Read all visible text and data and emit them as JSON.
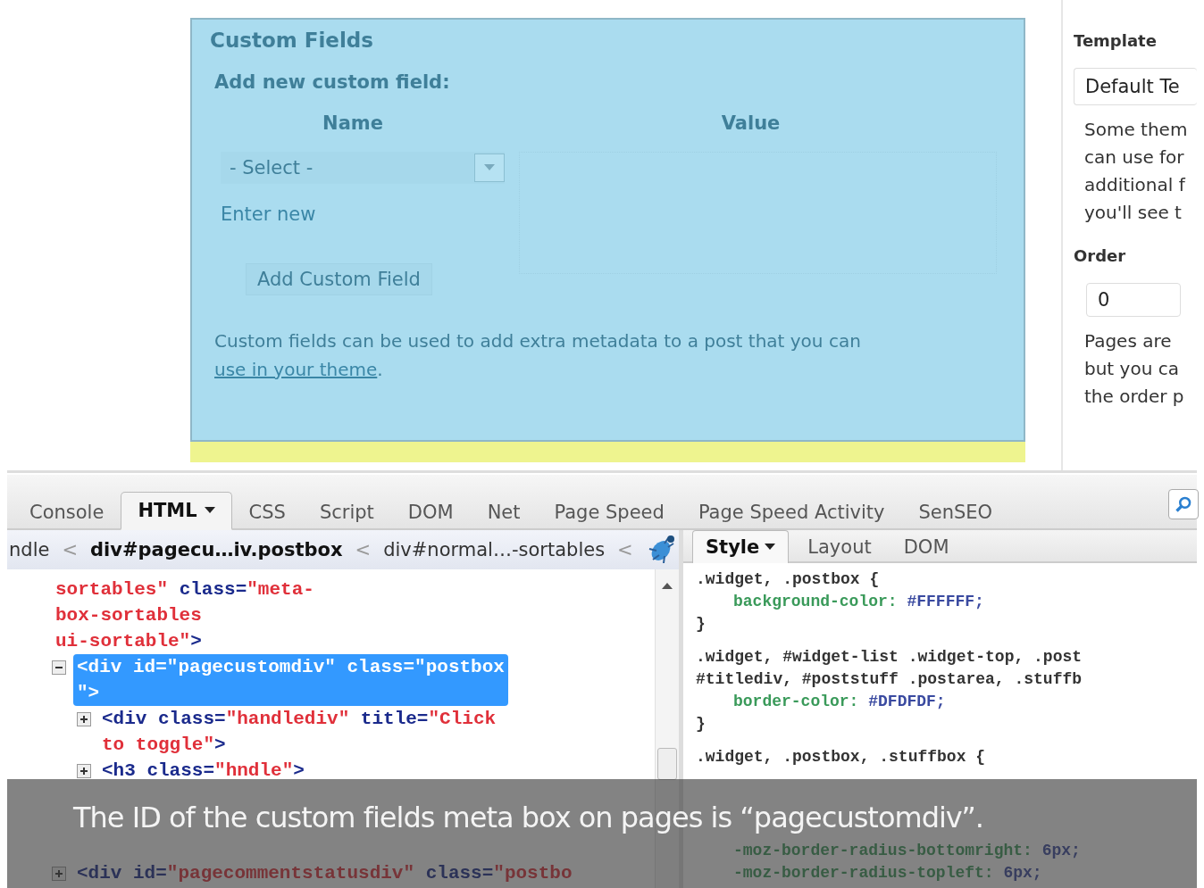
{
  "meta_box": {
    "title": "Custom Fields",
    "subtitle": "Add new custom field:",
    "columns": [
      "Name",
      "Value"
    ],
    "select": {
      "value": "- Select -"
    },
    "enter_new_link": "Enter new",
    "add_button": "Add Custom Field",
    "description": "Custom fields can be used to add extra metadata to a post that you can",
    "description_link": "use in your theme",
    "description_end": "."
  },
  "sidebar": {
    "template_label": "Template",
    "template_select": "Default Te",
    "template_help": [
      "Some them",
      "can use for",
      "additional f",
      "you'll see t"
    ],
    "order_label": "Order",
    "order_value": "0",
    "order_help": [
      "Pages are",
      "but you ca",
      "the order p"
    ]
  },
  "firebug": {
    "tabs": [
      {
        "label": "Console",
        "selected": false,
        "menu": false
      },
      {
        "label": "HTML",
        "selected": true,
        "menu": true
      },
      {
        "label": "CSS",
        "selected": false,
        "menu": false
      },
      {
        "label": "Script",
        "selected": false,
        "menu": false
      },
      {
        "label": "DOM",
        "selected": false,
        "menu": false
      },
      {
        "label": "Net",
        "selected": false,
        "menu": false
      },
      {
        "label": "Page Speed",
        "selected": false,
        "menu": false
      },
      {
        "label": "Page Speed Activity",
        "selected": false,
        "menu": false
      },
      {
        "label": "SenSEO",
        "selected": false,
        "menu": false
      }
    ],
    "breadcrumbs": [
      {
        "label": "ndle",
        "separator": "<",
        "selected": false
      },
      {
        "label": "div#pagecu…iv.postbox",
        "separator": "<",
        "selected": true
      },
      {
        "label": "div#normal…-sortables",
        "separator": "<",
        "selected": false
      }
    ],
    "html_tree": [
      {
        "lines": [
          [
            {
              "kind": "value",
              "text": "sortables\""
            },
            {
              "kind": "tag",
              "text": " class="
            },
            {
              "kind": "value",
              "text": "\"meta-"
            }
          ],
          [
            {
              "kind": "value",
              "text": "box-sortables"
            }
          ],
          [
            {
              "kind": "value",
              "text": "ui-sortable\""
            },
            {
              "kind": "tag",
              "text": ">"
            }
          ]
        ],
        "children": [
          {
            "selected": true,
            "expanded": true,
            "lines": [
              [
                {
                  "kind": "tag",
                  "text": "<div id="
                },
                {
                  "kind": "value",
                  "text": "\"pagecustomdiv\""
                },
                {
                  "kind": "tag",
                  "text": " class="
                },
                {
                  "kind": "value",
                  "text": "\"postbox"
                }
              ],
              [
                {
                  "kind": "value",
                  "text": "\""
                },
                {
                  "kind": "tag",
                  "text": ">"
                }
              ]
            ],
            "children": [
              {
                "selected": false,
                "expanded": false,
                "lines": [
                  [
                    {
                      "kind": "tag",
                      "text": "<div class="
                    },
                    {
                      "kind": "value",
                      "text": "\"handlediv\""
                    },
                    {
                      "kind": "tag",
                      "text": " title="
                    },
                    {
                      "kind": "value",
                      "text": "\"Click"
                    }
                  ],
                  [
                    {
                      "kind": "value",
                      "text": "to toggle\""
                    },
                    {
                      "kind": "tag",
                      "text": ">"
                    }
                  ]
                ]
              },
              {
                "selected": false,
                "expanded": false,
                "lines": [
                  [
                    {
                      "kind": "tag",
                      "text": "<h3 class="
                    },
                    {
                      "kind": "value",
                      "text": "\"hndle\""
                    },
                    {
                      "kind": "tag",
                      "text": ">"
                    }
                  ]
                ]
              }
            ]
          },
          {
            "selected": false,
            "expanded": false,
            "lines": [
              [
                {
                  "kind": "tag",
                  "text": "<div id="
                },
                {
                  "kind": "value",
                  "text": "\"pagecommentstatusdiv\""
                },
                {
                  "kind": "tag",
                  "text": " class="
                },
                {
                  "kind": "value",
                  "text": "\"postbo"
                }
              ]
            ]
          }
        ]
      }
    ],
    "side_tabs": [
      {
        "label": "Style",
        "selected": true,
        "menu": true
      },
      {
        "label": "Layout",
        "selected": false,
        "menu": false
      },
      {
        "label": "DOM",
        "selected": false,
        "menu": false
      }
    ],
    "css_rules": [
      {
        "selector": [
          ".widget, .postbox {"
        ],
        "declarations": [
          {
            "property": "background-color:",
            "value": "#FFFFFF;"
          }
        ],
        "close": "}"
      },
      {
        "selector": [
          ".widget, #widget-list .widget-top, .post",
          "#titlediv, #poststuff .postarea, .stuffb"
        ],
        "declarations": [
          {
            "property": "border-color:",
            "value": "#DFDFDF;"
          }
        ],
        "close": "}"
      },
      {
        "selector": [
          ".widget, .postbox, .stuffbox {"
        ],
        "declarations": [
          {
            "property": "-moz-border-radius-bottomright:",
            "value": "6px;"
          },
          {
            "property": "-moz-border-radius-topleft:",
            "value": "6px;"
          }
        ]
      }
    ]
  },
  "caption": "The ID of the custom fields meta box on pages is “pagecustomdiv”."
}
